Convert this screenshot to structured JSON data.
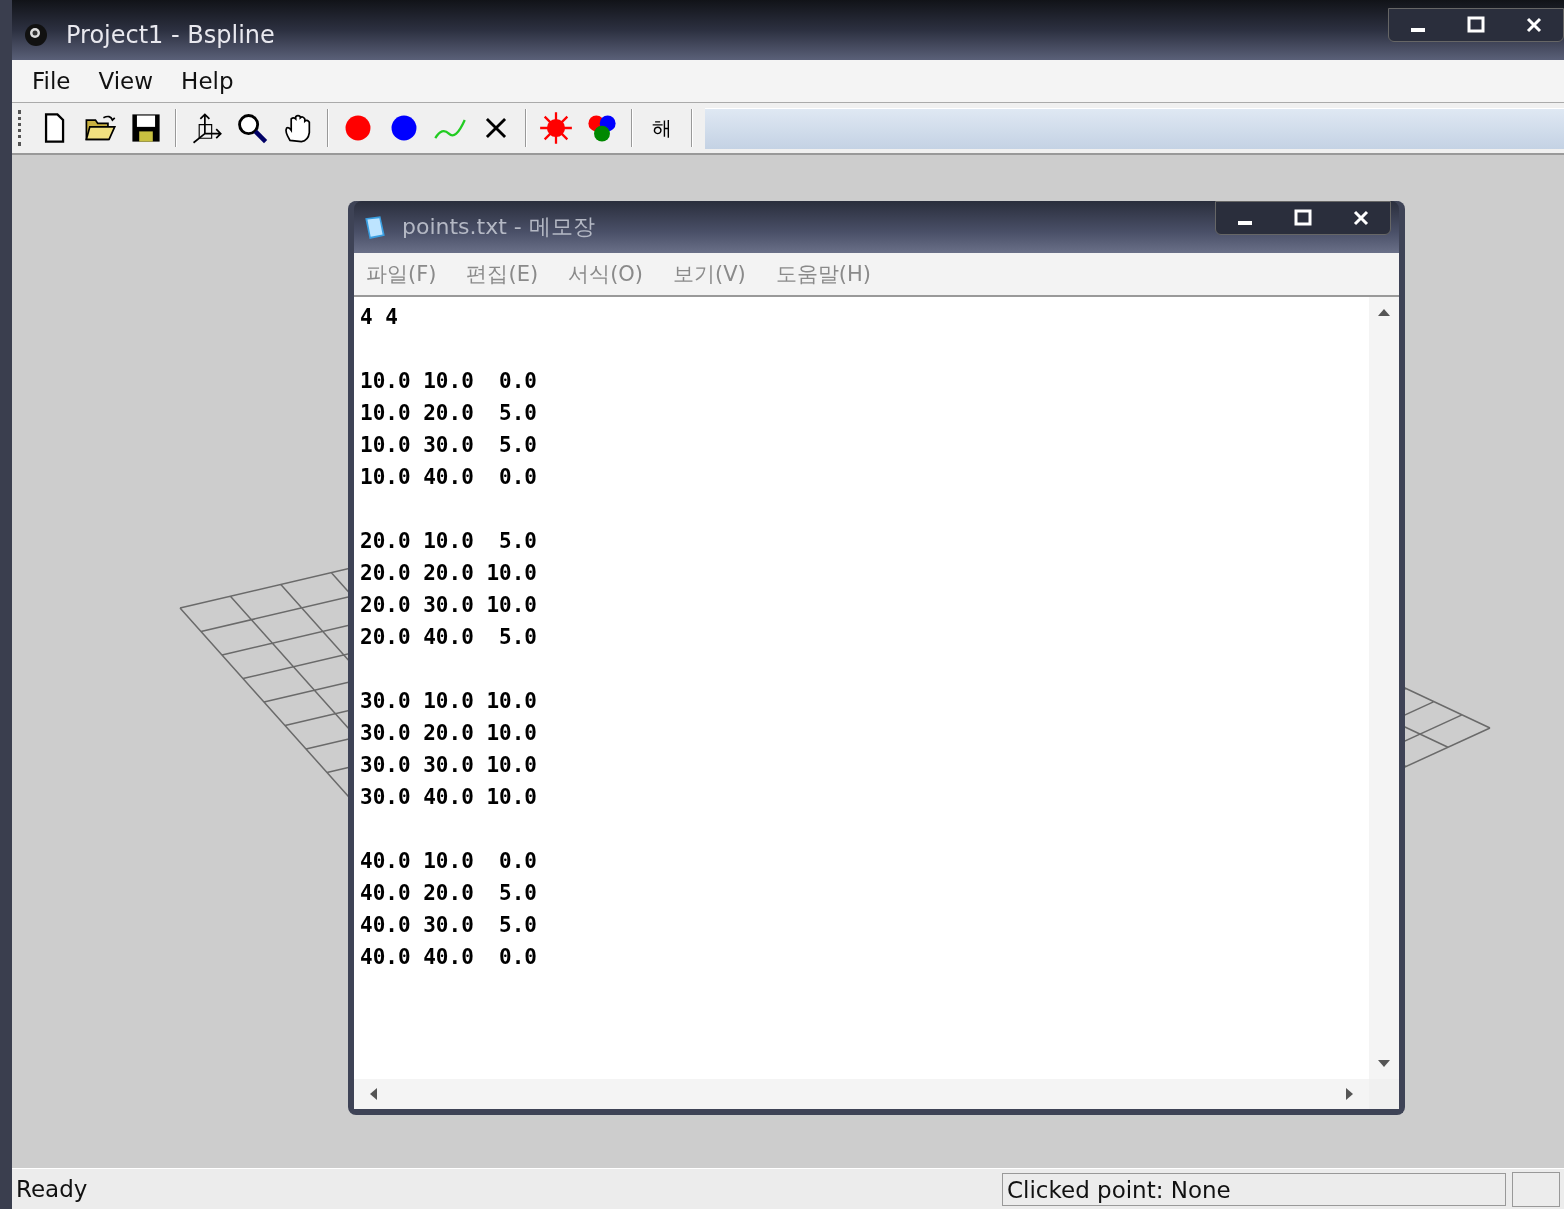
{
  "window": {
    "title": "Project1 - Bspline"
  },
  "menu": [
    {
      "label": "File"
    },
    {
      "label": "View"
    },
    {
      "label": "Help"
    }
  ],
  "toolbar": {
    "groups": [
      [
        {
          "kind": "new"
        },
        {
          "kind": "open"
        },
        {
          "kind": "save"
        }
      ],
      [
        {
          "kind": "axes"
        },
        {
          "kind": "zoom"
        },
        {
          "kind": "pan"
        }
      ],
      [
        {
          "kind": "red-dot"
        },
        {
          "kind": "blue-dot"
        },
        {
          "kind": "curve"
        },
        {
          "kind": "cross"
        }
      ],
      [
        {
          "kind": "burst"
        },
        {
          "kind": "balls"
        }
      ],
      [
        {
          "kind": "text",
          "label": "해"
        }
      ]
    ]
  },
  "notepad": {
    "title": "points.txt - 메모장",
    "menu": [
      "파일(F)",
      "편집(E)",
      "서식(O)",
      "보기(V)",
      "도움말(H)"
    ],
    "header": "4 4",
    "blocks": [
      [
        "10.0 10.0  0.0",
        "10.0 20.0  5.0",
        "10.0 30.0  5.0",
        "10.0 40.0  0.0"
      ],
      [
        "20.0 10.0  5.0",
        "20.0 20.0 10.0",
        "20.0 30.0 10.0",
        "20.0 40.0  5.0"
      ],
      [
        "30.0 10.0 10.0",
        "30.0 20.0 10.0",
        "30.0 30.0 10.0",
        "30.0 40.0 10.0"
      ],
      [
        "40.0 10.0  0.0",
        "40.0 20.0  5.0",
        "40.0 30.0  5.0",
        "40.0 40.0  0.0"
      ]
    ]
  },
  "status_bar": {
    "message": "Ready",
    "clicked_point": "Clicked point: None"
  }
}
